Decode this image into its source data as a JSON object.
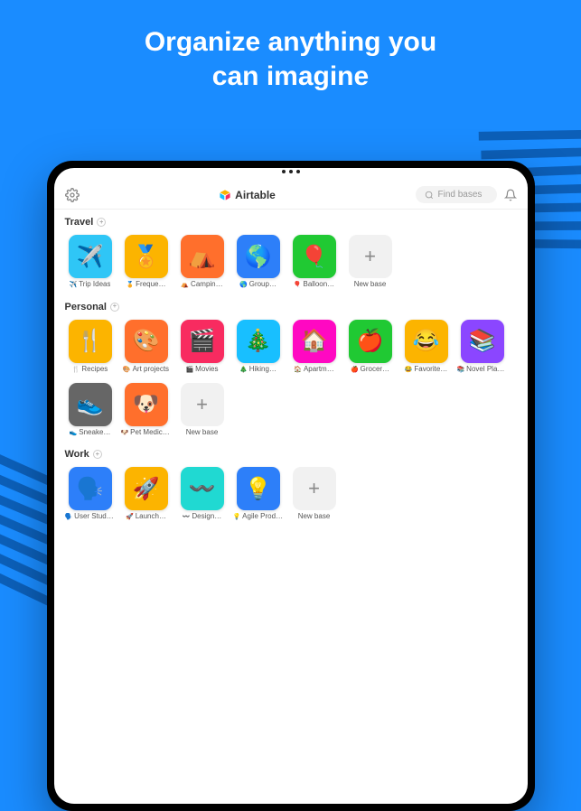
{
  "headline_line1": "Organize anything you",
  "headline_line2": "can imagine",
  "brand_name": "Airtable",
  "search_placeholder": "Find bases",
  "sections": [
    {
      "name": "Travel",
      "bases": [
        {
          "emoji": "✈️",
          "label": "Trip Ideas",
          "prefix": "✈️ ",
          "color": "#2fc6f6"
        },
        {
          "emoji": "🏅",
          "label": "Freque…",
          "prefix": "🏅 ",
          "color": "#fcb400"
        },
        {
          "emoji": "⛺",
          "label": "Campin…",
          "prefix": "⛺ ",
          "color": "#ff6f2c"
        },
        {
          "emoji": "🌎",
          "label": "Group…",
          "prefix": "🌎 ",
          "color": "#2d7ff9"
        },
        {
          "emoji": "🎈",
          "label": "Balloon…",
          "prefix": "🎈 ",
          "color": "#20c933"
        }
      ]
    },
    {
      "name": "Personal",
      "bases": [
        {
          "emoji": "🍴",
          "label": "Recipes",
          "prefix": "🍴 ",
          "color": "#fcb400"
        },
        {
          "emoji": "🎨",
          "label": "Art projects",
          "prefix": "🎨 ",
          "color": "#ff6f2c"
        },
        {
          "emoji": "🎬",
          "label": "Movies",
          "prefix": "🎬 ",
          "color": "#f82b60"
        },
        {
          "emoji": "🎄",
          "label": "Hiking…",
          "prefix": "🎄 ",
          "color": "#18bfff"
        },
        {
          "emoji": "🏠",
          "label": "Apartm…",
          "prefix": "🏠 ",
          "color": "#ff08c2"
        },
        {
          "emoji": "🍎",
          "label": "Grocer…",
          "prefix": "🍎 ",
          "color": "#20c933"
        },
        {
          "emoji": "😂",
          "label": "Favorite…",
          "prefix": "😂 ",
          "color": "#fcb400"
        },
        {
          "emoji": "📚",
          "label": "Novel Planning",
          "prefix": "📚 ",
          "color": "#8b46ff"
        },
        {
          "emoji": "👟",
          "label": "Sneake…",
          "prefix": "👟 ",
          "color": "#666666"
        },
        {
          "emoji": "🐶",
          "label": "Pet Medical…",
          "prefix": "🐶 ",
          "color": "#ff6f2c"
        }
      ]
    },
    {
      "name": "Work",
      "bases": [
        {
          "emoji": "🗣️",
          "label": "User Studies",
          "prefix": "🗣️ ",
          "color": "#2d7ff9"
        },
        {
          "emoji": "🚀",
          "label": "Launch…",
          "prefix": "🚀 ",
          "color": "#fcb400"
        },
        {
          "emoji": "〰️",
          "label": "Design…",
          "prefix": "〰️ ",
          "color": "#20d9d2"
        },
        {
          "emoji": "💡",
          "label": "Agile Product…",
          "prefix": "💡 ",
          "color": "#2d7ff9"
        }
      ]
    }
  ],
  "new_base_label": "New base"
}
